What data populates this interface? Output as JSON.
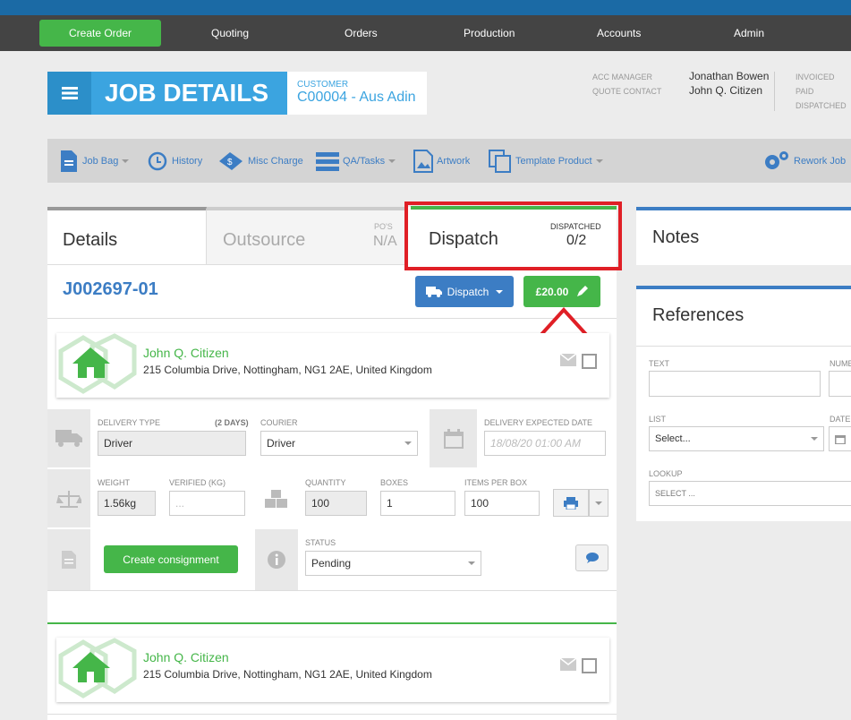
{
  "nav": {
    "create": "Create Order",
    "items": [
      "Quoting",
      "Orders",
      "Production",
      "Accounts",
      "Admin"
    ]
  },
  "header": {
    "title": "JOB DETAILS",
    "customer_label": "CUSTOMER",
    "customer_value": "C00004 - Aus Adin",
    "acc_manager_label": "ACC MANAGER",
    "quote_contact_label": "QUOTE CONTACT",
    "acc_manager": "Jonathan Bowen",
    "quote_contact": "John Q. Citizen",
    "status_labels": [
      "INVOICED",
      "PAID",
      "DISPATCHED"
    ]
  },
  "toolbar": {
    "job_bag": "Job Bag",
    "history": "History",
    "misc": "Misc Charge",
    "qa": "QA/Tasks",
    "artwork": "Artwork",
    "template": "Template Product",
    "rework": "Rework Job"
  },
  "tabs": {
    "details": "Details",
    "outsource": "Outsource",
    "pos_label": "PO'S",
    "pos_value": "N/A",
    "dispatch": "Dispatch",
    "dispatched_label": "DISPATCHED",
    "dispatched_value": "0/2"
  },
  "job": {
    "number": "J002697-01",
    "dispatch_btn": "Dispatch",
    "price_btn": "£20.00"
  },
  "address1": {
    "name": "John Q. Citizen",
    "address": "215 Columbia Drive, Nottingham, NG1 2AE, United Kingdom"
  },
  "address2": {
    "name": "John Q. Citizen",
    "address": "215 Columbia Drive, Nottingham, NG1 2AE, United Kingdom"
  },
  "delivery": {
    "type_label": "DELIVERY TYPE",
    "days": "(2 DAYS)",
    "type_value": "Driver",
    "courier_label": "COURIER",
    "courier_value": "Driver",
    "expected_label": "DELIVERY EXPECTED DATE",
    "expected_placeholder": "18/08/20 01:00 AM",
    "weight_label": "WEIGHT",
    "weight_value": "1.56kg",
    "verified_label": "VERIFIED (KG)",
    "verified_placeholder": "...",
    "qty_label": "QUANTITY",
    "qty_value": "100",
    "boxes_label": "BOXES",
    "boxes_value": "1",
    "ipb_label": "ITEMS PER BOX",
    "ipb_value": "100",
    "consign_btn": "Create consignment",
    "status_label": "STATUS",
    "status_value": "Pending"
  },
  "notes": {
    "title": "Notes"
  },
  "refs": {
    "title": "References",
    "text_label": "TEXT",
    "num_label": "NUME",
    "list_label": "LIST",
    "list_value": "Select...",
    "date_label": "DATE",
    "lookup_label": "LOOKUP",
    "lookup_placeholder": "SELECT ..."
  },
  "colors": {
    "accent": "#3ba4e0",
    "green": "#45b649",
    "red_highlight": "#e01f26"
  }
}
